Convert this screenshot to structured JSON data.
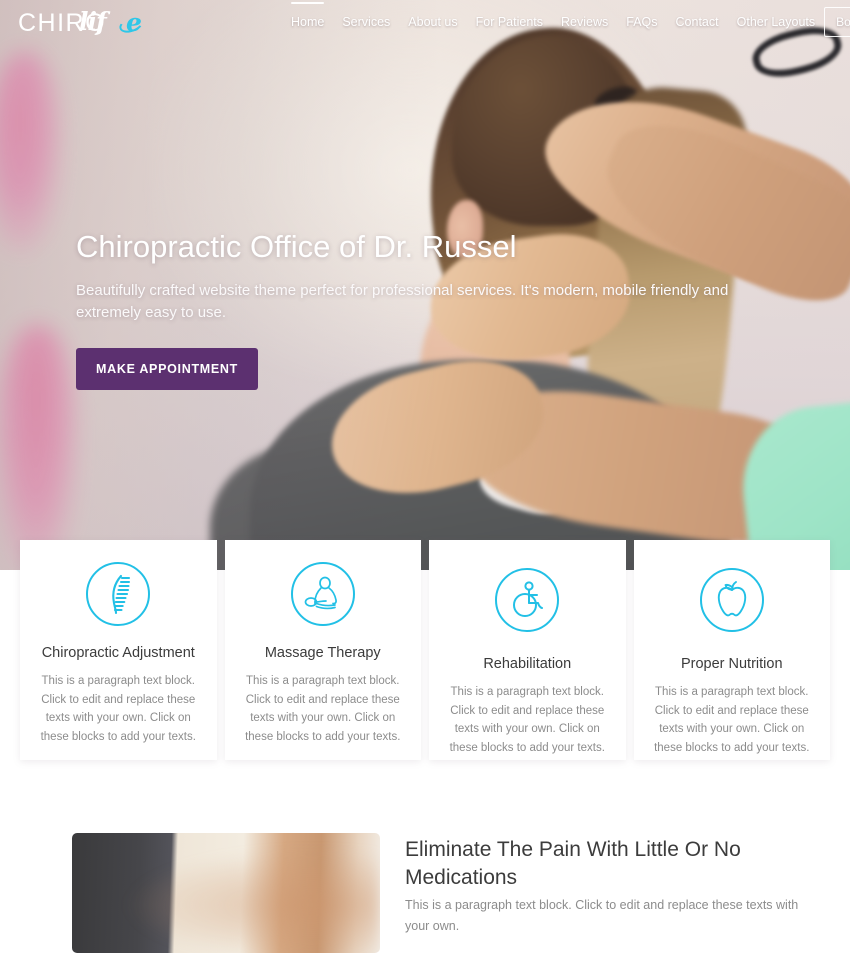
{
  "header": {
    "logo": {
      "primary": "CHIRO",
      "script": "lif",
      "accent_letter": "e",
      "accent_color": "#2ec7e8"
    },
    "nav": [
      {
        "label": "Home",
        "active": true
      },
      {
        "label": "Services",
        "active": false
      },
      {
        "label": "About us",
        "active": false
      },
      {
        "label": "For Patients",
        "active": false
      },
      {
        "label": "Reviews",
        "active": false
      },
      {
        "label": "FAQs",
        "active": false
      },
      {
        "label": "Contact",
        "active": false
      },
      {
        "label": "Other Layouts",
        "active": false
      }
    ],
    "book_button": "Book Appointment"
  },
  "hero": {
    "title": "Chiropractic Office of Dr. Russel",
    "subtitle": "Beautifully crafted website theme perfect for professional services. It's modern, mobile friendly and extremely easy to use.",
    "cta_label": "MAKE APPOINTMENT",
    "cta_color": "#5c3070"
  },
  "services": {
    "accent_color": "#22c0e6",
    "cards": [
      {
        "icon": "spine-icon",
        "title": "Chiropractic Adjustment",
        "text": "This is a paragraph text block. Click to edit and replace these texts with your own. Click on these blocks to add your texts."
      },
      {
        "icon": "massage-icon",
        "title": "Massage Therapy",
        "text": "This is a paragraph text block. Click to edit and replace these texts with your own. Click on these blocks to add your texts."
      },
      {
        "icon": "wheelchair-icon",
        "title": "Rehabilitation",
        "text": "This is a paragraph text block. Click to edit and replace these texts with your own. Click on these blocks to add your texts."
      },
      {
        "icon": "apple-icon",
        "title": "Proper Nutrition",
        "text": "This is a paragraph text block. Click to edit and replace these texts with your own. Click on these blocks to add your texts."
      }
    ]
  },
  "feature": {
    "heading": "Eliminate The Pain With Little Or No Medications",
    "body": "This is a paragraph text block. Click to edit and replace these texts with your own."
  }
}
